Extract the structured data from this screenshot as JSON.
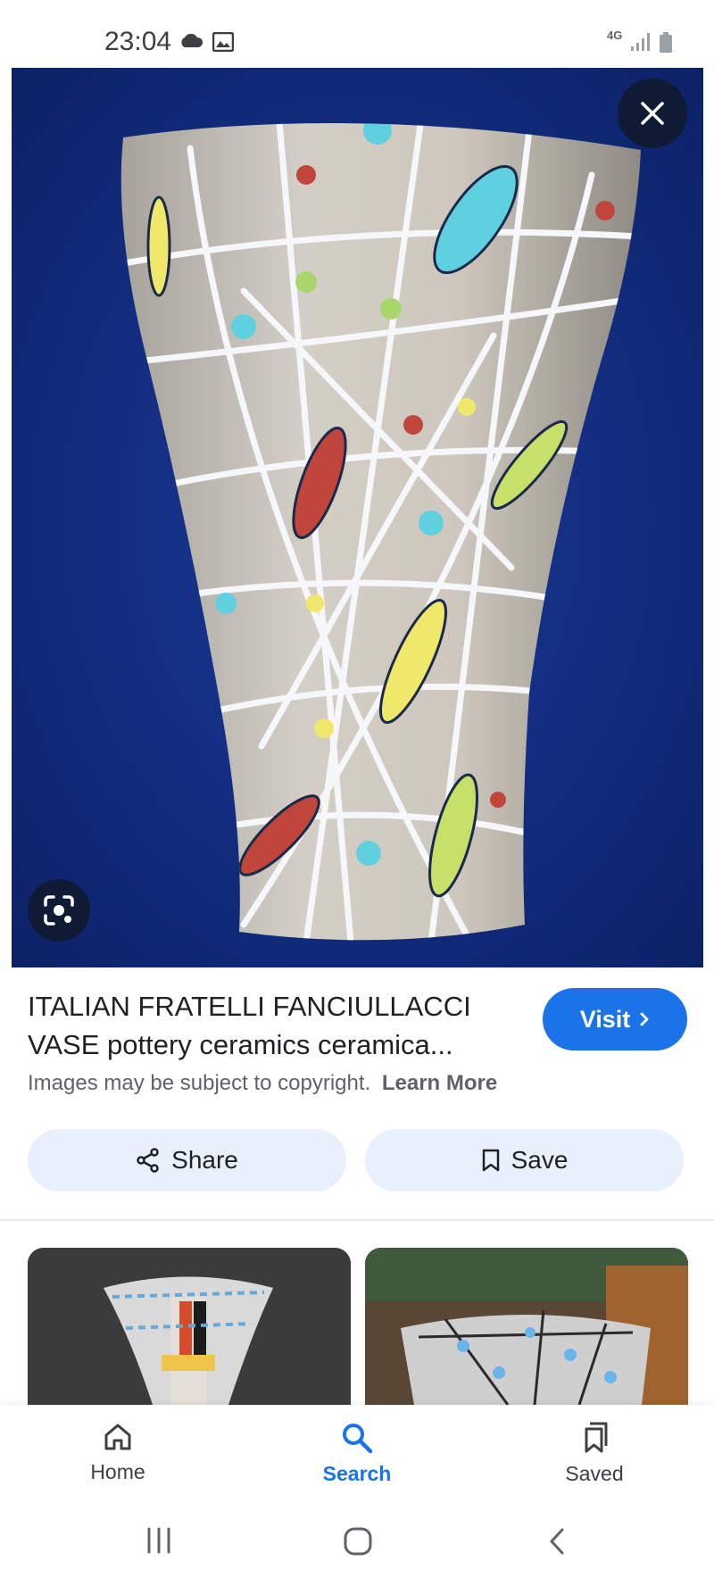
{
  "status_bar": {
    "time": "23:04",
    "network": "4G",
    "icons": [
      "cloud-icon",
      "gallery-icon",
      "signal-icon",
      "battery-icon"
    ]
  },
  "image_viewer": {
    "close_icon": "close-icon",
    "lens_icon": "lens-icon"
  },
  "result": {
    "title_line1": "ITALIAN FRATELLI FANCIULLACCI",
    "title_line2": "VASE pottery ceramics ceramica...",
    "visit_label": "Visit",
    "copyright_text": "Images may be subject to copyright.",
    "learn_more_label": "Learn More"
  },
  "actions": {
    "share_label": "Share",
    "save_label": "Save"
  },
  "bottom_nav": {
    "items": [
      {
        "label": "Home",
        "icon": "home-icon"
      },
      {
        "label": "Search",
        "icon": "search-icon",
        "active": true
      },
      {
        "label": "Saved",
        "icon": "saved-icon"
      }
    ]
  },
  "colors": {
    "accent": "#1a73e8",
    "button_tint": "#e8f0fc",
    "image_background": "#102a7a"
  }
}
